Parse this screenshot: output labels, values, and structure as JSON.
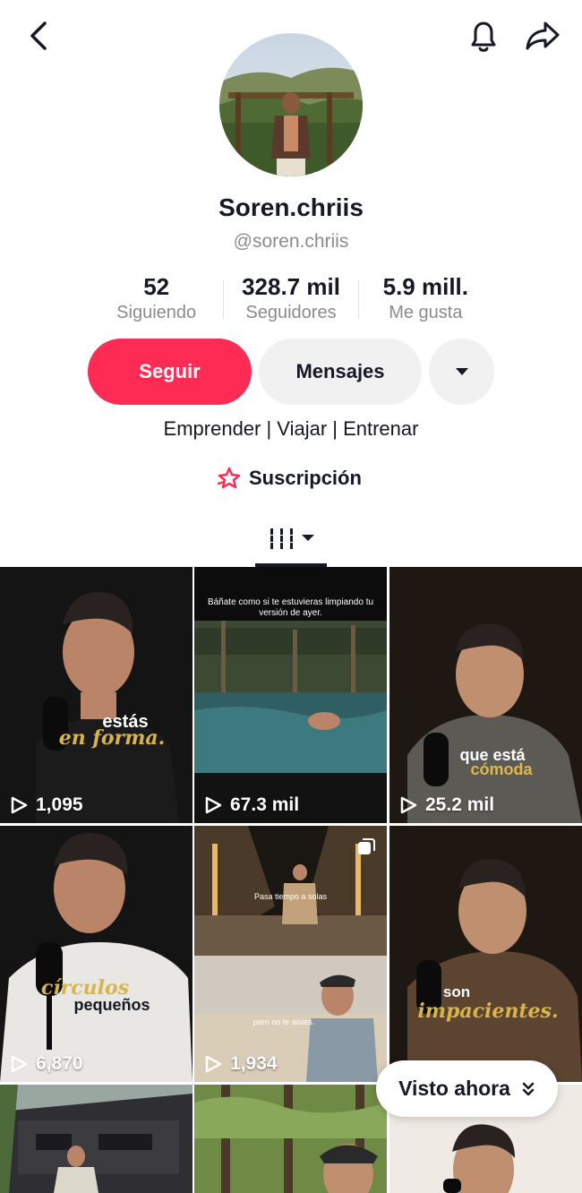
{
  "header": {
    "back_icon": "chevron-left-icon",
    "bell_icon": "bell-icon",
    "share_icon": "share-arrow-icon"
  },
  "profile": {
    "display_name": "Soren.chriis",
    "handle": "@soren.chriis",
    "bio": "Emprender | Viajar | Entrenar",
    "subscription_label": "Suscripción",
    "subscription_icon": "star-badge-icon"
  },
  "stats": [
    {
      "value": "52",
      "label": "Siguiendo"
    },
    {
      "value": "328.7 mil",
      "label": "Seguidores"
    },
    {
      "value": "5.9 mill.",
      "label": "Me gusta"
    }
  ],
  "actions": {
    "follow_label": "Seguir",
    "message_label": "Mensajes",
    "more_icon": "caret-down-icon"
  },
  "tabs": {
    "videos_icon": "grid-bars-icon",
    "dropdown_icon": "caret-down-icon"
  },
  "videos": [
    {
      "views": "1,095",
      "caption_top": "estás",
      "caption_bottom": "en forma."
    },
    {
      "views": "67.3 mil",
      "caption_top": "Báñate como si te estuvieras limpiando tu versión de ayer."
    },
    {
      "views": "25.2 mil",
      "caption_top": "que está",
      "caption_bottom": "cómoda"
    },
    {
      "views": "6,870",
      "caption_top": "círculos",
      "caption_bottom": "pequeños"
    },
    {
      "views": "1,934",
      "caption_top": "Pasa tiempo a solas",
      "caption_bottom": "pero no te aisles."
    },
    {
      "caption_top": "son",
      "caption_bottom": "impacientes."
    }
  ],
  "colors": {
    "accent": "#fe2c55",
    "gold_caption": "#d9b44a",
    "secondary_text": "#8a8b91",
    "button_gray": "#f1f1f2"
  },
  "floating": {
    "visto_label": "Visto ahora",
    "visto_icon": "double-chevron-down-icon"
  }
}
